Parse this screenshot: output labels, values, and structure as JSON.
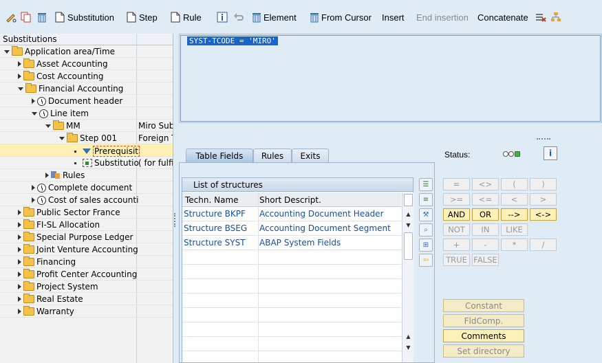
{
  "toolbar": {
    "substitution": "Substitution",
    "step": "Step",
    "rule": "Rule",
    "element": "Element",
    "from_cursor": "From Cursor",
    "insert": "Insert",
    "end_insertion": "End insertion",
    "concatenate": "Concatenate"
  },
  "tree": {
    "header": "Substitutions",
    "items": [
      {
        "label": "Application area/Time",
        "desc": ""
      },
      {
        "label": "Asset Accounting",
        "desc": ""
      },
      {
        "label": "Cost Accounting",
        "desc": ""
      },
      {
        "label": "Financial Accounting",
        "desc": ""
      },
      {
        "label": "Document header",
        "desc": ""
      },
      {
        "label": "Line item",
        "desc": ""
      },
      {
        "label": "MM",
        "desc": "Miro Subs"
      },
      {
        "label": "Step 001",
        "desc": "Foreign T"
      },
      {
        "label": "Prerequisit",
        "desc": ""
      },
      {
        "label": "Substitutio",
        "desc": "( for fulfil"
      },
      {
        "label": "Rules",
        "desc": ""
      },
      {
        "label": "Complete document",
        "desc": ""
      },
      {
        "label": "Cost of sales accounti",
        "desc": ""
      },
      {
        "label": "Public Sector France",
        "desc": ""
      },
      {
        "label": "FI-SL Allocation",
        "desc": ""
      },
      {
        "label": "Special Purpose Ledger",
        "desc": ""
      },
      {
        "label": "Joint Venture Accounting",
        "desc": ""
      },
      {
        "label": "Financing",
        "desc": ""
      },
      {
        "label": "Profit Center Accounting",
        "desc": ""
      },
      {
        "label": "Project System",
        "desc": ""
      },
      {
        "label": "Real Estate",
        "desc": ""
      },
      {
        "label": "Warranty",
        "desc": ""
      }
    ]
  },
  "editor": {
    "code": "SYST-TCODE = 'MIRO'"
  },
  "tabs": [
    "Table Fields",
    "Rules",
    "Exits"
  ],
  "structures": {
    "title": "List of structures",
    "columns": [
      "Techn. Name",
      "Short Descript."
    ],
    "rows": [
      [
        "Structure BKPF",
        "Accounting Document Header"
      ],
      [
        "Structure BSEG",
        "Accounting Document Segment"
      ],
      [
        "Structure SYST",
        "ABAP System Fields"
      ]
    ]
  },
  "status": {
    "label": "Status:"
  },
  "operators": {
    "eq": "=",
    "ne": "<>",
    "lp": "(",
    "rp": ")",
    "ge": ">=",
    "le": "<=",
    "lt": "<",
    "gt": ">",
    "and": "AND",
    "or": "OR",
    "impl": "-->",
    "equiv": "<->",
    "not": "NOT",
    "in": "IN",
    "like": "LIKE",
    "plus": "+",
    "minus": "-",
    "times": "*",
    "div": "/",
    "true": "TRUE",
    "false": "FALSE"
  },
  "actions": {
    "constant": "Constant",
    "fldcomp": "FldComp.",
    "comments": "Comments",
    "set_directory": "Set directory"
  }
}
